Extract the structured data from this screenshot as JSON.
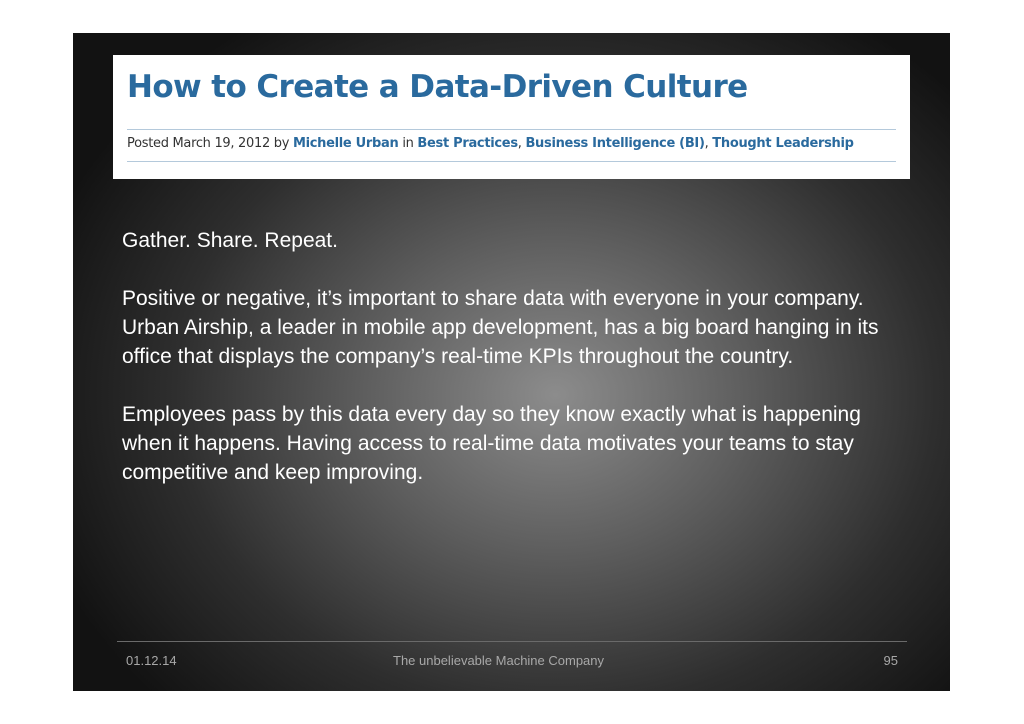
{
  "header": {
    "title": "How to Create a Data-Driven Culture",
    "posted_prefix": "Posted March 19, 2012 by ",
    "author": "Michelle Urban",
    "in_word": " in ",
    "category_1": "Best Practices",
    "separator_1": ", ",
    "category_2": "Business Intelligence (BI)",
    "separator_2": ", ",
    "category_3": "Thought Leadership"
  },
  "body": {
    "paragraph_1": "Gather. Share. Repeat.",
    "paragraph_2": "Positive or negative, it’s important to share data with everyone in your company. Urban Airship, a leader in mobile app development, has a big board hanging in its office that displays the company’s real-time KPIs throughout the country.",
    "paragraph_3": "Employees pass by this data every day so they know exactly what is happening when it happens. Having access to real-time data motivates your teams to stay competitive and keep improving."
  },
  "footer": {
    "date": "01.12.14",
    "company": "The unbelievable Machine Company",
    "page_number": "95"
  }
}
